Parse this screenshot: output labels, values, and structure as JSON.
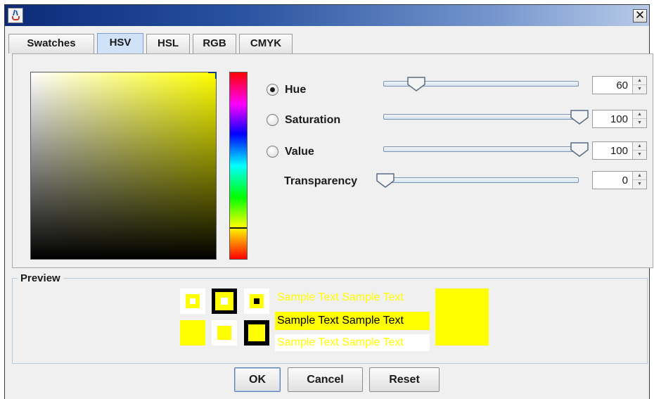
{
  "tabs": [
    {
      "label": "Swatches"
    },
    {
      "label": "HSV"
    },
    {
      "label": "HSL"
    },
    {
      "label": "RGB"
    },
    {
      "label": "CMYK"
    }
  ],
  "selected_tab": "HSV",
  "controls": {
    "hue": {
      "label": "Hue",
      "value": "60",
      "selected": true,
      "position": 0.167
    },
    "saturation": {
      "label": "Saturation",
      "value": "100",
      "selected": false,
      "position": 1.0
    },
    "value": {
      "label": "Value",
      "value": "100",
      "selected": false,
      "position": 1.0
    },
    "transparency": {
      "label": "Transparency",
      "value": "0",
      "position": 0.0
    }
  },
  "preview": {
    "title": "Preview",
    "sample_text": "Sample Text"
  },
  "buttons": {
    "ok": "OK",
    "cancel": "Cancel",
    "reset": "Reset"
  },
  "colors": {
    "selected": "#ffff00",
    "accent_tab": "#cfe2f7"
  },
  "icons": {
    "app": "java-cup-icon",
    "close": "close-icon"
  }
}
